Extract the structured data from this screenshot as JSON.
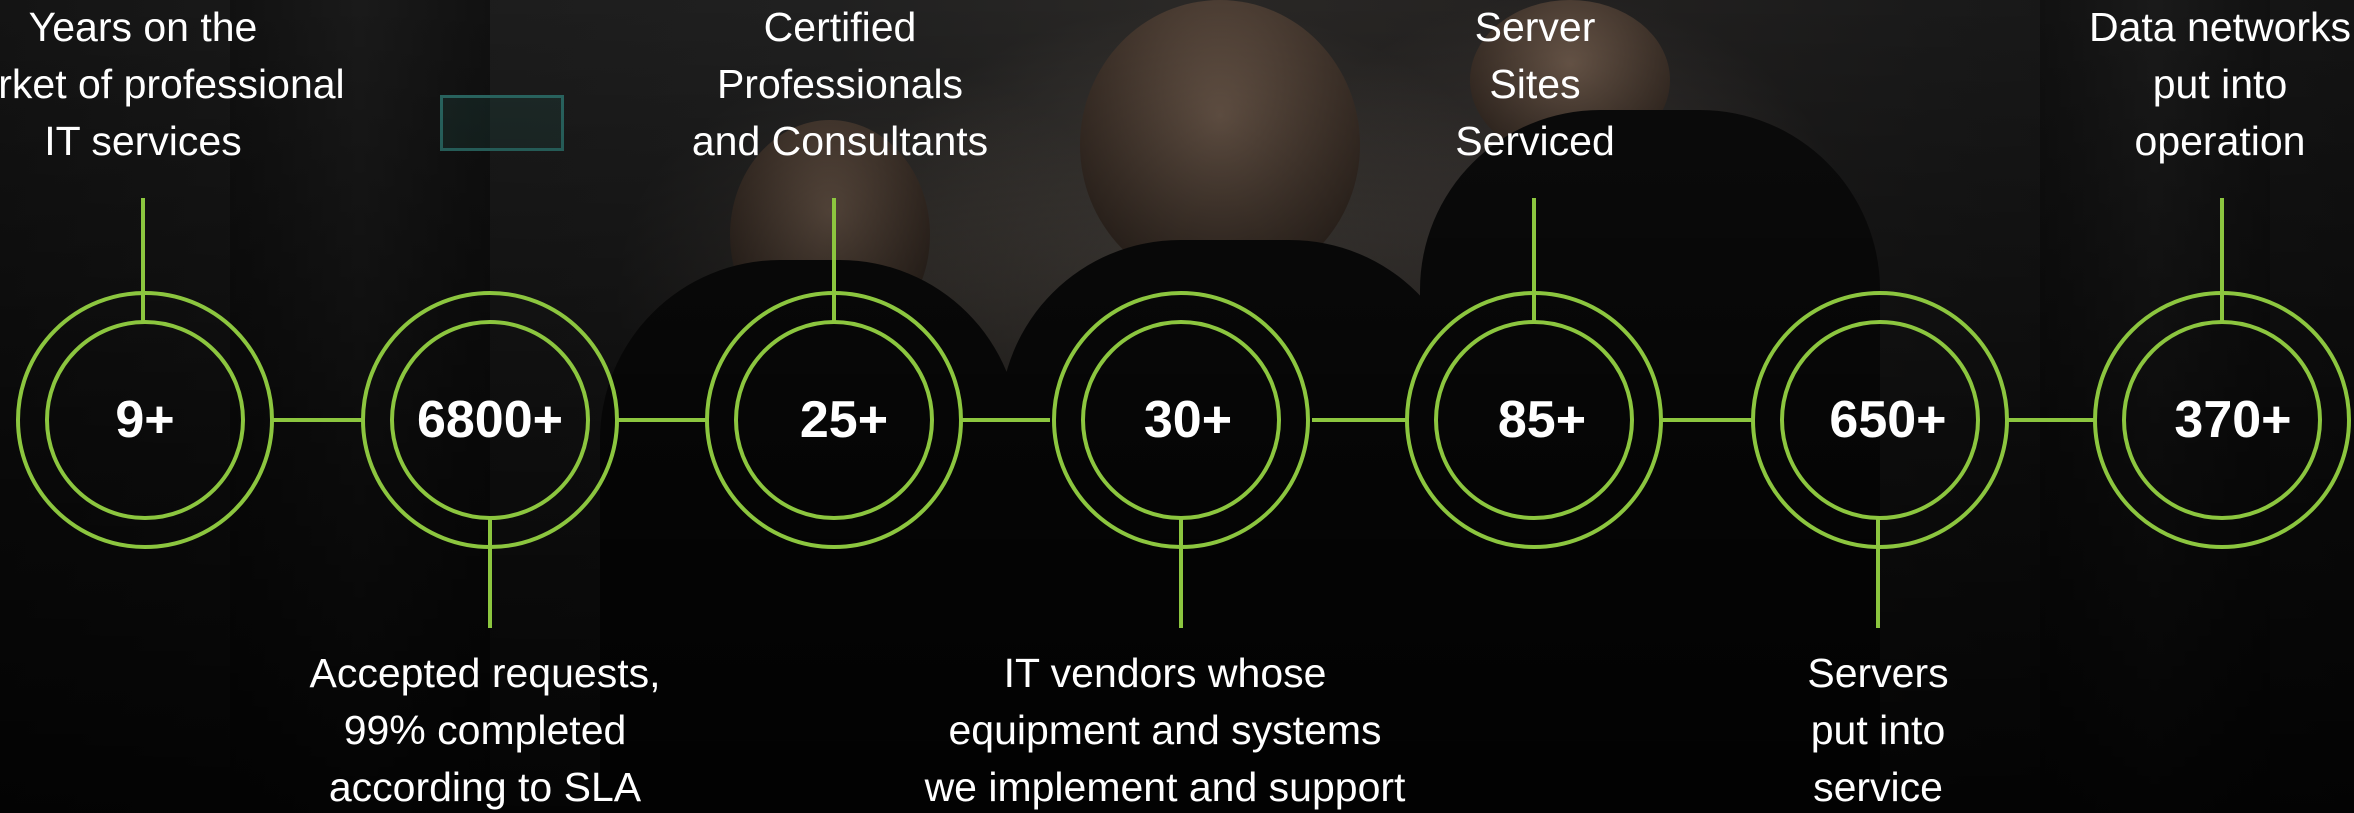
{
  "accent_color": "#8cc63f",
  "stats": [
    {
      "value": "9+",
      "label": "Years on the\nmarket of professional\nIT services"
    },
    {
      "value": "6800+",
      "label": "Accepted requests,\n99% completed\naccording to SLA"
    },
    {
      "value": "25+",
      "label": "Certified\nProfessionals\nand Consultants"
    },
    {
      "value": "30+",
      "label": "IT vendors whose\nequipment and systems\nwe implement and support"
    },
    {
      "value": "85+",
      "label": "Server\nSites\nServiced"
    },
    {
      "value": "650+",
      "label": "Servers\nput into\nservice"
    },
    {
      "value": "370+",
      "label": "Data networks\nput into\noperation"
    }
  ]
}
